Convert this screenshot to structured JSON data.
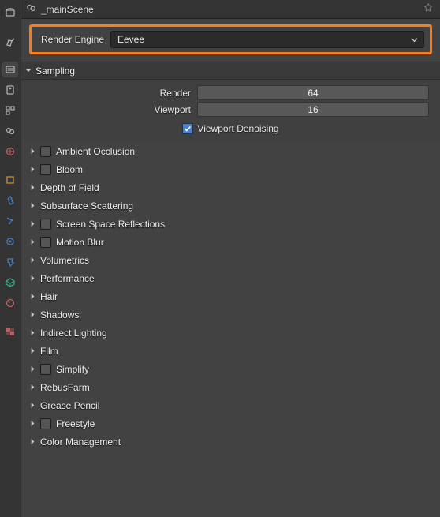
{
  "header": {
    "scene_name": "_mainScene"
  },
  "render_engine": {
    "label": "Render Engine",
    "value": "Eevee"
  },
  "sampling": {
    "title": "Sampling",
    "render_label": "Render",
    "render_value": "64",
    "viewport_label": "Viewport",
    "viewport_value": "16",
    "denoise_label": "Viewport Denoising",
    "denoise_checked": true
  },
  "panels": [
    {
      "label": "Ambient Occlusion",
      "checkbox": true
    },
    {
      "label": "Bloom",
      "checkbox": true
    },
    {
      "label": "Depth of Field",
      "checkbox": false
    },
    {
      "label": "Subsurface Scattering",
      "checkbox": false
    },
    {
      "label": "Screen Space Reflections",
      "checkbox": true
    },
    {
      "label": "Motion Blur",
      "checkbox": true
    },
    {
      "label": "Volumetrics",
      "checkbox": false
    },
    {
      "label": "Performance",
      "checkbox": false
    },
    {
      "label": "Hair",
      "checkbox": false
    },
    {
      "label": "Shadows",
      "checkbox": false
    },
    {
      "label": "Indirect Lighting",
      "checkbox": false
    },
    {
      "label": "Film",
      "checkbox": false
    },
    {
      "label": "Simplify",
      "checkbox": true
    },
    {
      "label": "RebusFarm",
      "checkbox": false
    },
    {
      "label": "Grease Pencil",
      "checkbox": false
    },
    {
      "label": "Freestyle",
      "checkbox": true
    },
    {
      "label": "Color Management",
      "checkbox": false
    }
  ],
  "vtabs": [
    {
      "name": "editor-type-icon",
      "color": "#c8c8c8"
    },
    {
      "name": "tool-icon",
      "color": "#c8c8c8"
    },
    {
      "name": "render-icon",
      "color": "#c8c8c8"
    },
    {
      "name": "output-icon",
      "color": "#c8c8c8"
    },
    {
      "name": "view-layer-icon",
      "color": "#c8c8c8"
    },
    {
      "name": "scene-icon",
      "color": "#c8c8c8"
    },
    {
      "name": "world-icon",
      "color": "#d46a6a"
    },
    {
      "name": "object-icon",
      "color": "#e8a23c"
    },
    {
      "name": "modifier-icon",
      "color": "#4b8fdd"
    },
    {
      "name": "particle-icon",
      "color": "#4b8fdd"
    },
    {
      "name": "physics-icon",
      "color": "#4b8fdd"
    },
    {
      "name": "constraint-icon",
      "color": "#4b8fdd"
    },
    {
      "name": "mesh-data-icon",
      "color": "#36c49a"
    },
    {
      "name": "material-icon",
      "color": "#d46a6a"
    },
    {
      "name": "texture-icon",
      "color": "#d46a6a"
    }
  ]
}
